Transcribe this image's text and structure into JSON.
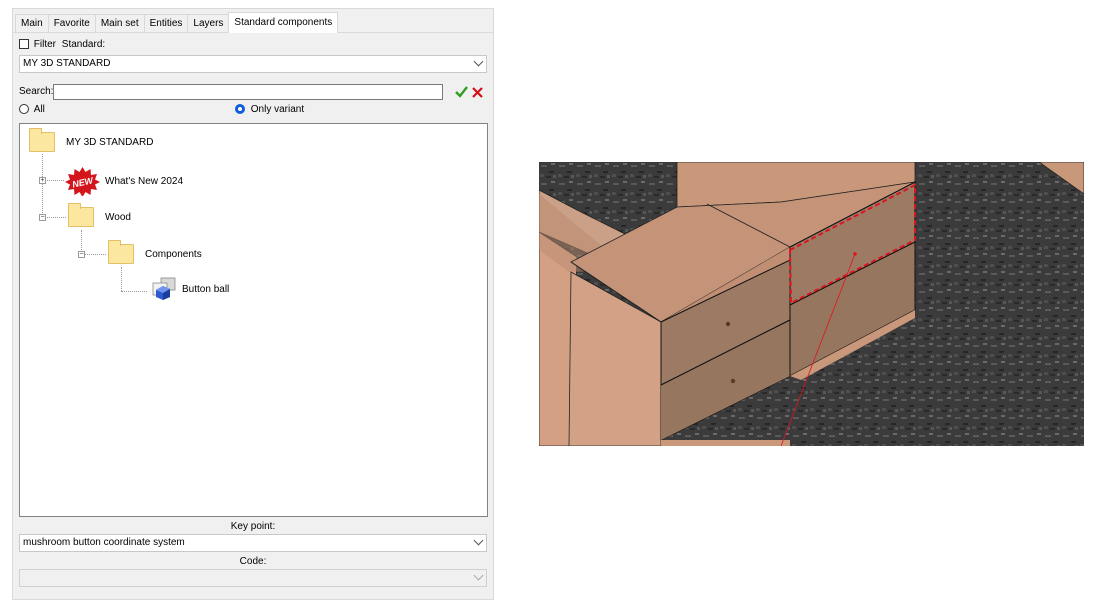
{
  "tabs": [
    "Main",
    "Favorite",
    "Main set",
    "Entities",
    "Layers",
    "Standard components"
  ],
  "filter": {
    "label": "Filter",
    "standard_label": "Standard:",
    "checked": false
  },
  "standard_select": {
    "value": "MY 3D STANDARD"
  },
  "search": {
    "label": "Search:",
    "value": ""
  },
  "mode": {
    "all_label": "All",
    "only_variant_label": "Only variant",
    "selected": "Only variant"
  },
  "tree": {
    "root": "MY 3D STANDARD",
    "whats_new": "What's New 2024",
    "new_badge": "NEW",
    "wood": "Wood",
    "components": "Components",
    "button_ball": "Button ball"
  },
  "key_point": {
    "label": "Key point:",
    "value": "mushroom button coordinate system"
  },
  "code": {
    "label": "Code:",
    "value": ""
  },
  "colors": {
    "accent": "#0b5ed7",
    "selection_outline": "#e0141e",
    "wood": "#c9977a"
  },
  "icons": {
    "ok": "check-icon",
    "cancel": "x-icon"
  }
}
